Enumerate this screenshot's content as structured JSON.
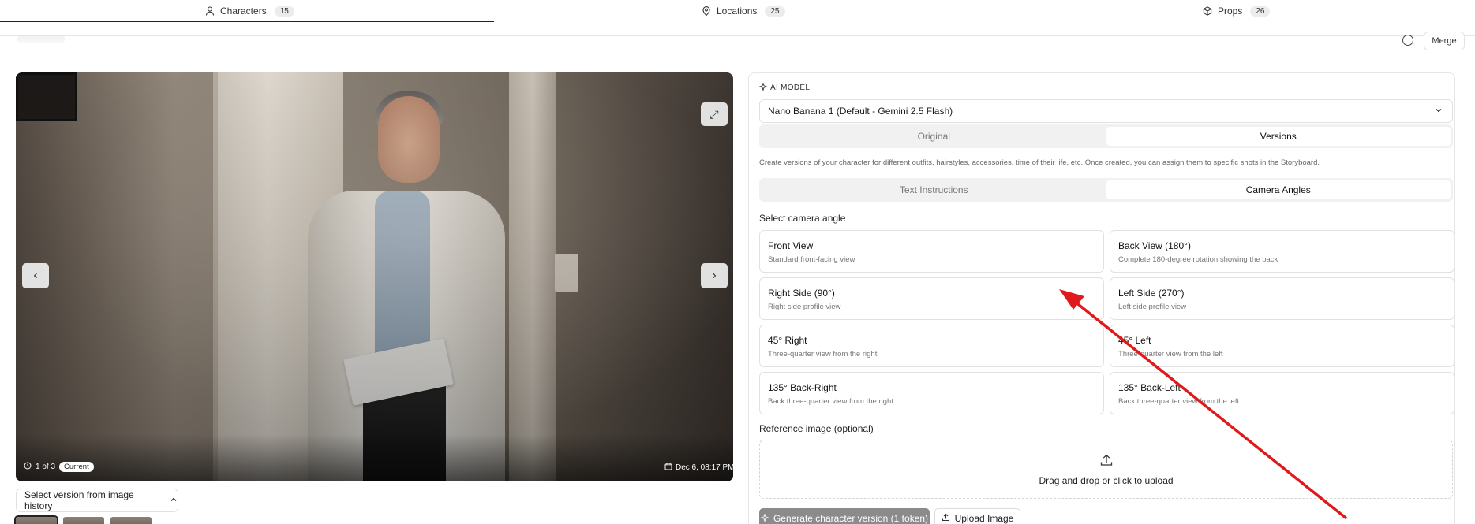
{
  "tabs": [
    {
      "label": "Characters",
      "count": "15",
      "icon": "person-icon"
    },
    {
      "label": "Locations",
      "count": "25",
      "icon": "map-pin-icon"
    },
    {
      "label": "Props",
      "count": "26",
      "icon": "box-icon"
    }
  ],
  "header": {
    "merge_label": "Merge"
  },
  "viewer": {
    "counter": "1 of 3",
    "current_badge": "Current",
    "date": "Dec 6, 08:17 PM",
    "prev_glyph": "‹",
    "next_glyph": "›",
    "expand_glyph": "⤢"
  },
  "history": {
    "select_label": "Select version from image history"
  },
  "panel": {
    "ai_model_label": "AI MODEL",
    "model_value": "Nano Banana 1 (Default - Gemini 2.5 Flash)",
    "mode_tabs": [
      "Original",
      "Versions"
    ],
    "mode_active": "Versions",
    "description": "Create versions of your character for different outfits, hairstyles, accessories, time of their life, etc. Once created, you can assign them to specific shots in the Storyboard.",
    "instruction_tabs": [
      "Text Instructions",
      "Camera Angles"
    ],
    "instruction_active": "Camera Angles",
    "select_angle_label": "Select camera angle",
    "angles": [
      {
        "title": "Front View",
        "subtitle": "Standard front-facing view"
      },
      {
        "title": "Back View (180°)",
        "subtitle": "Complete 180-degree rotation showing the back"
      },
      {
        "title": "Right Side (90°)",
        "subtitle": "Right side profile view"
      },
      {
        "title": "Left Side (270°)",
        "subtitle": "Left side profile view"
      },
      {
        "title": "45° Right",
        "subtitle": "Three-quarter view from the right"
      },
      {
        "title": "45° Left",
        "subtitle": "Three-quarter view from the left"
      },
      {
        "title": "135° Back-Right",
        "subtitle": "Back three-quarter view from the right"
      },
      {
        "title": "135° Back-Left",
        "subtitle": "Back three-quarter view from the left"
      }
    ],
    "reference_label": "Reference image (optional)",
    "dropzone_text": "Drag and drop or click to upload",
    "generate_label": "Generate character version (1 token)",
    "upload_label": "Upload Image"
  },
  "annotation": {
    "arrow_color": "#e0191b"
  }
}
